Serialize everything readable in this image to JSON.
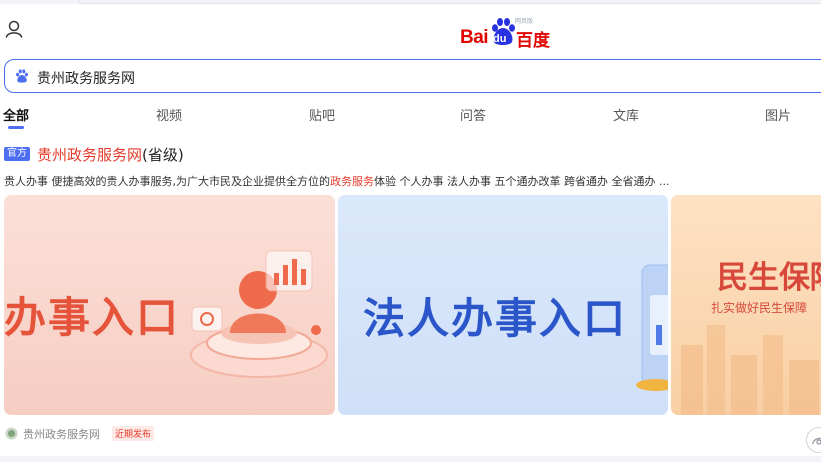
{
  "header": {
    "logo_left": "Bai",
    "logo_paw_text": "du",
    "logo_cn": "百度",
    "logo_sup": "网页版",
    "brand_color": "#e10601"
  },
  "search": {
    "query": "贵州政务服务网",
    "border_color": "#4e6ef2"
  },
  "tabs": [
    {
      "label": "全部",
      "active": true
    },
    {
      "label": "视频"
    },
    {
      "label": "贴吧"
    },
    {
      "label": "问答"
    },
    {
      "label": "文库"
    },
    {
      "label": "图片"
    }
  ],
  "result": {
    "badge": "官方",
    "title_link": "贵州政务服务网",
    "title_rest": "(省级)",
    "snippet_a": "贵人办事 便捷高效的贵人办事服务,为广大市民及企业提供全方位的",
    "snippet_hl": "政务服务",
    "snippet_b": "体验 个人办事 法人办事 五个通办改革 跨省通办 全省通办 ...",
    "banners": [
      {
        "text": "办事入口"
      },
      {
        "text": "法人办事入口"
      },
      {
        "text": "民生保障",
        "sub": "扎实做好民生保障"
      }
    ],
    "source": "贵州政务服务网",
    "recent_tag": "近期发布"
  },
  "icons": {
    "user": "user-icon",
    "search_paw": "baidu-paw-icon",
    "source": "gov-emblem-icon",
    "assistant": "assistant-icon"
  },
  "colors": {
    "accent": "#4e6ef2",
    "highlight": "#e43b2b"
  }
}
